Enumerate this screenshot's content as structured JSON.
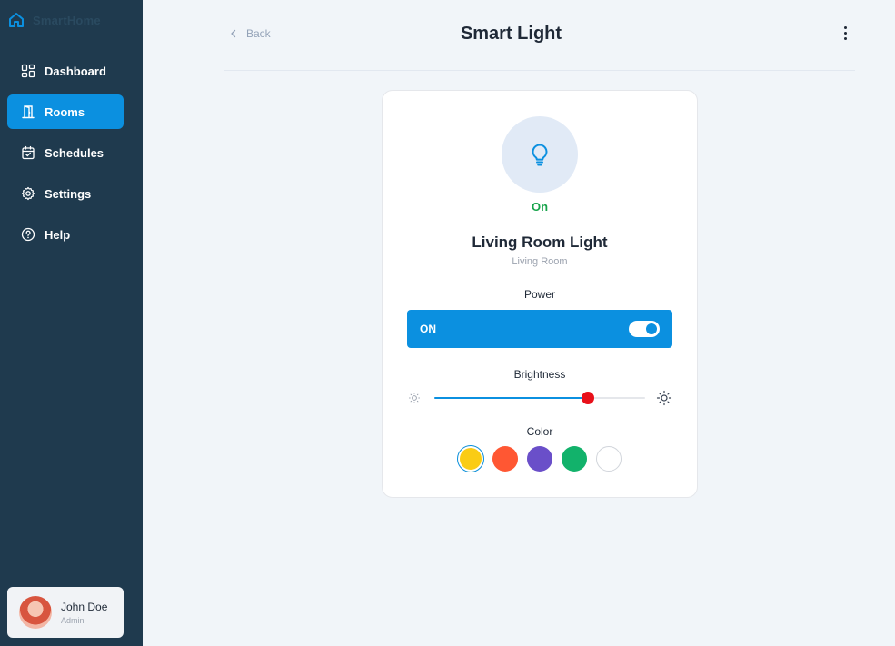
{
  "app": {
    "brand_name": "SmartHome",
    "brand_color": "#0b90e0",
    "sidebar_bg": "#1f3a4e"
  },
  "sidebar": {
    "items": [
      {
        "label": "Dashboard",
        "icon": "grid-icon",
        "active": false
      },
      {
        "label": "Rooms",
        "icon": "door-icon",
        "active": true
      },
      {
        "label": "Schedules",
        "icon": "calendar-check-icon",
        "active": false
      },
      {
        "label": "Settings",
        "icon": "gear-icon",
        "active": false
      },
      {
        "label": "Help",
        "icon": "help-circle-icon",
        "active": false
      }
    ]
  },
  "user": {
    "name": "John Doe",
    "role": "Admin"
  },
  "header": {
    "back_label": "Back",
    "title": "Smart Light",
    "menu_icon": "more-vertical-icon"
  },
  "device": {
    "icon": "lightbulb-icon",
    "state_label": "On",
    "state_color": "#16a34a",
    "name": "Living Room Light",
    "room": "Living Room",
    "power": {
      "label": "Power",
      "value": "ON",
      "on": true
    },
    "brightness": {
      "label": "Brightness",
      "level": 0.73,
      "low_icon": "sun-dim-icon",
      "high_icon": "sun-bright-icon",
      "thumb_color": "#e8101a"
    },
    "color": {
      "label": "Color",
      "options": [
        {
          "name": "yellow",
          "hex": "#facc15",
          "selected": true
        },
        {
          "name": "orange",
          "hex": "#ff5733"
        },
        {
          "name": "purple",
          "hex": "#6a4fc9"
        },
        {
          "name": "green",
          "hex": "#12b26b"
        },
        {
          "name": "white",
          "hex": "#ffffff"
        }
      ]
    }
  }
}
